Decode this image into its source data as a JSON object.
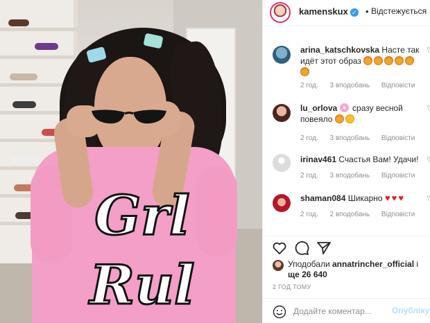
{
  "post": {
    "author": "kamenskux",
    "follow_status": "Відстежується",
    "dot": "•",
    "photo_print_line1": "Grl",
    "photo_print_line2": "Rul"
  },
  "comments": [
    {
      "username": "arina_katschkovska",
      "text": "Насте так идёт этот образ",
      "emoji": [
        "star-struck",
        "star-struck",
        "star-struck",
        "star-struck",
        "star-struck",
        "star-struck"
      ],
      "time": "2 год.",
      "likes": "3 вподобань",
      "reply": "Відповісти"
    },
    {
      "username": "lu_orlova",
      "text_after": "сразу весной повеяло",
      "emoji": [
        "cherry-blossom",
        "star-struck",
        "smiling-face"
      ],
      "time": "2 год.",
      "likes": "3 вподобань",
      "reply": "Відповісти"
    },
    {
      "username": "irinav461",
      "text": "Счастья Вам! Удачи!",
      "time": "2 год.",
      "likes": "3 вподобань",
      "reply": "Відповісти"
    },
    {
      "username": "shaman084",
      "text": "Шикарно",
      "emoji": [
        "red-heart",
        "red-heart",
        "red-heart"
      ],
      "time": "2 год.",
      "likes": "2 вподобань",
      "reply": "Відповісти"
    }
  ],
  "likes_info": {
    "prefix": "Уподобали",
    "user": "annatrincher_official",
    "suffix": "і",
    "count_text": "ще 26 640"
  },
  "time_ago": "2 ГОД ТОМУ",
  "add_comment": {
    "placeholder": "Додайте коментар...",
    "publish": "Опублікув"
  },
  "icons": {
    "like": "heart-outline-icon",
    "comment": "comment-bubble-icon",
    "share": "paper-plane-icon",
    "emoji": "smiley-icon",
    "verified": "verified-badge-icon"
  }
}
